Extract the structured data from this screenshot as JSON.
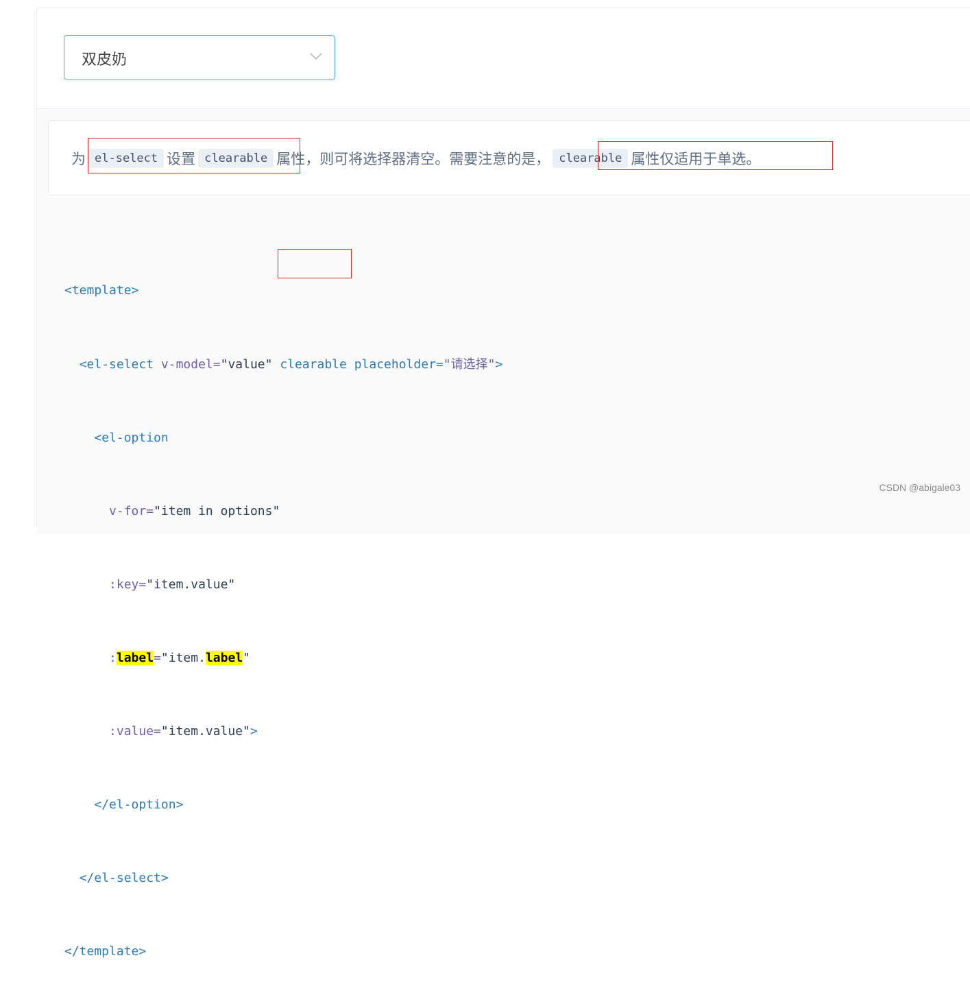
{
  "select": {
    "value": "双皮奶",
    "accent_color": "#409eff",
    "icon": "chevron-down-icon"
  },
  "description": {
    "prefix": "为",
    "code1": "el-select",
    "mid1": "设置",
    "code2": "clearable",
    "mid2": "属性，则可将选择器清空。需要注意的是，",
    "code3": "clearable",
    "suffix": "属性仅适用于单选。"
  },
  "code": {
    "l1": "<template>",
    "l2_tag": "<el-select",
    "l2_attr1": "v-model=",
    "l2_val1": "\"value\"",
    "l2_attr2": "clearable",
    "l2_attr3": "placeholder=",
    "l2_q1": "\"",
    "l2_zh": "请选择",
    "l2_q2": "\"",
    "l2_end": ">",
    "l3": "<el-option",
    "l4_attr": "v-for=",
    "l4_val": "\"item in options\"",
    "l5_attr": ":key=",
    "l5_val": "\"item.value\"",
    "l6_colon": ":",
    "l6_label": "label",
    "l6_eq": "=",
    "l6_v1": "\"item.",
    "l6_label2": "label",
    "l6_v2": "\"",
    "l7_attr": ":value=",
    "l7_val": "\"item.value\"",
    "l7_end": ">",
    "l8": "</el-option>",
    "l9": "</el-select>",
    "l10": "</template>"
  },
  "colors": {
    "tag": "#2b7ab9",
    "attr": "#6f5fa8",
    "highlight": "#ffff00",
    "annotation_box": "#d42b2b"
  },
  "watermark": "CSDN @abigale03"
}
